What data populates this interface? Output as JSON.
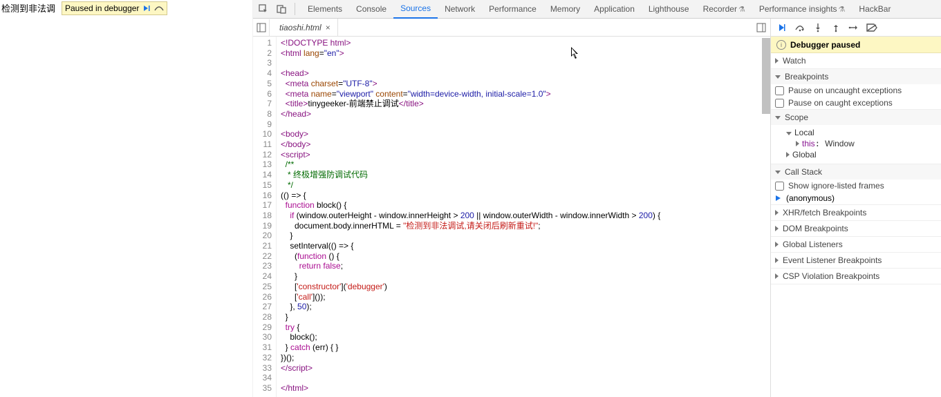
{
  "page": {
    "detected_text": "检测到非法调"
  },
  "paused_chip": {
    "label": "Paused in debugger"
  },
  "devtools": {
    "tabs": [
      "Elements",
      "Console",
      "Sources",
      "Network",
      "Performance",
      "Memory",
      "Application",
      "Lighthouse",
      "Recorder",
      "Performance insights",
      "HackBar"
    ],
    "active_tab": "Sources"
  },
  "file_tab": {
    "name": "tiaoshi.html"
  },
  "code_lines": [
    {
      "n": 1,
      "html": "<span class='tag'>&lt;!DOCTYPE html&gt;</span>"
    },
    {
      "n": 2,
      "html": "<span class='tag'>&lt;html</span> <span class='attr'>lang</span>=<span class='val'>\"en\"</span><span class='tag'>&gt;</span>"
    },
    {
      "n": 3,
      "html": ""
    },
    {
      "n": 4,
      "html": "<span class='tag'>&lt;head&gt;</span>"
    },
    {
      "n": 5,
      "html": "  <span class='tag'>&lt;meta</span> <span class='attr'>charset</span>=<span class='val'>\"UTF-8\"</span><span class='tag'>&gt;</span>"
    },
    {
      "n": 6,
      "html": "  <span class='tag'>&lt;meta</span> <span class='attr'>name</span>=<span class='val'>\"viewport\"</span> <span class='attr'>content</span>=<span class='val'>\"width=device-width, initial-scale=1.0\"</span><span class='tag'>&gt;</span>"
    },
    {
      "n": 7,
      "html": "  <span class='tag'>&lt;title&gt;</span>tinygeeker-前端禁止调试<span class='tag'>&lt;/title&gt;</span>"
    },
    {
      "n": 8,
      "html": "<span class='tag'>&lt;/head&gt;</span>"
    },
    {
      "n": 9,
      "html": ""
    },
    {
      "n": 10,
      "html": "<span class='tag'>&lt;body&gt;</span>"
    },
    {
      "n": 11,
      "html": "<span class='tag'>&lt;/body&gt;</span>"
    },
    {
      "n": 12,
      "html": "<span class='tag'>&lt;script&gt;</span>"
    },
    {
      "n": 13,
      "html": "  <span class='com'>/**</span>"
    },
    {
      "n": 14,
      "html": "   <span class='com'>* 终极增强防调试代码</span>"
    },
    {
      "n": 15,
      "html": "   <span class='com'>*/</span>"
    },
    {
      "n": 16,
      "html": "(() =&gt; {"
    },
    {
      "n": 17,
      "html": "  <span class='kw'>function</span> <span class='fn'>block</span>() {"
    },
    {
      "n": 18,
      "html": "    <span class='kw'>if</span> (window.outerHeight - window.innerHeight &gt; <span class='num'>200</span> || window.outerWidth - window.innerWidth &gt; <span class='num'>200</span>) {"
    },
    {
      "n": 19,
      "html": "      document.body.innerHTML = <span class='str'>\"检测到非法调试,请关闭后刷新重试!\"</span>;"
    },
    {
      "n": 20,
      "html": "    }"
    },
    {
      "n": 21,
      "html": "    setInterval(() =&gt; {"
    },
    {
      "n": 22,
      "html": "      (<span class='kw'>function</span> () {"
    },
    {
      "n": 23,
      "html": "        <span class='kw'>return</span> <span class='kw'>false</span>;"
    },
    {
      "n": 24,
      "html": "      }"
    },
    {
      "n": 25,
      "html": "      [<span class='str'>'constructor'</span>](<span class='str'>'debugger'</span>)"
    },
    {
      "n": 26,
      "html": "      [<span class='str'>'call'</span>]());"
    },
    {
      "n": 27,
      "html": "    }, <span class='num'>50</span>);"
    },
    {
      "n": 28,
      "html": "  }"
    },
    {
      "n": 29,
      "html": "  <span class='kw'>try</span> {"
    },
    {
      "n": 30,
      "html": "    block();"
    },
    {
      "n": 31,
      "html": "  } <span class='kw'>catch</span> (err) { }"
    },
    {
      "n": 32,
      "html": "})();"
    },
    {
      "n": 33,
      "html": "<span class='tag'>&lt;/script&gt;</span>"
    },
    {
      "n": 34,
      "html": ""
    },
    {
      "n": 35,
      "html": "<span class='tag'>&lt;/html&gt;</span>"
    }
  ],
  "sidebar": {
    "paused_banner": "Debugger paused",
    "watch": "Watch",
    "breakpoints": "Breakpoints",
    "pause_uncaught": "Pause on uncaught exceptions",
    "pause_caught": "Pause on caught exceptions",
    "scope": "Scope",
    "local": "Local",
    "this_label": "this",
    "this_value": "Window",
    "global": "Global",
    "callstack": "Call Stack",
    "ignore_listed": "Show ignore-listed frames",
    "current_frame": "(anonymous)",
    "xhr": "XHR/fetch Breakpoints",
    "dom": "DOM Breakpoints",
    "global_listeners": "Global Listeners",
    "event_listener": "Event Listener Breakpoints",
    "csp": "CSP Violation Breakpoints"
  }
}
